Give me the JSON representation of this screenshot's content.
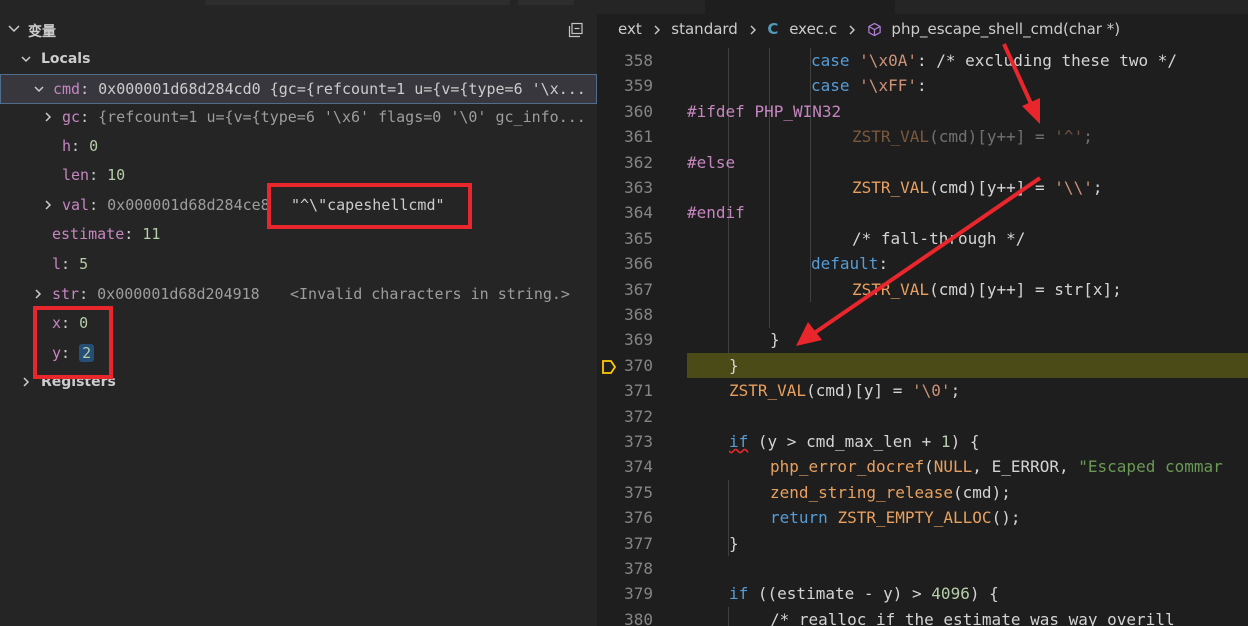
{
  "variables": {
    "section_title": "变量",
    "locals_label": "Locals",
    "rows": {
      "cmd": {
        "name": "cmd",
        "value": "0x000001d68d284cd0 {gc={refcount=1 u={v={type=6 '\\x..."
      },
      "gc": {
        "name": "gc",
        "value": "{refcount=1 u={v={type=6 '\\x6' flags=0 '\\0' gc_info..."
      },
      "h": {
        "name": "h",
        "value": "0"
      },
      "len": {
        "name": "len",
        "value": "10"
      },
      "val": {
        "name": "val",
        "addr": "0x000001d68d284ce8",
        "value": "\"^\\\"capeshellcmd\""
      },
      "estimate": {
        "name": "estimate",
        "value": "11"
      },
      "l": {
        "name": "l",
        "value": "5"
      },
      "str": {
        "name": "str",
        "addr": "0x000001d68d204918",
        "value": "<Invalid characters in string.>"
      },
      "x": {
        "name": "x",
        "value": "0"
      },
      "y": {
        "name": "y",
        "value": "2"
      }
    },
    "registers_label": "Registers"
  },
  "breadcrumb": {
    "items": [
      "ext",
      "standard",
      "exec.c",
      "php_escape_shell_cmd(char *)"
    ],
    "file_icon_text": "C"
  },
  "code": {
    "line_numbers": [
      "358",
      "359",
      "360",
      "361",
      "362",
      "363",
      "364",
      "365",
      "366",
      "367",
      "368",
      "369",
      "370",
      "371",
      "372",
      "373",
      "374",
      "375",
      "376",
      "377",
      "378",
      "379",
      "380"
    ],
    "current_line": "370",
    "tokens": {
      "l358": [
        "case",
        "'\\x0A'",
        ": ",
        "/* excluding these two */"
      ],
      "l359": [
        "case",
        "'\\xFF'",
        ":"
      ],
      "l360": [
        "#ifdef",
        "PHP_WIN32"
      ],
      "l361": [
        "ZSTR_VAL",
        "(cmd)[y++] = ",
        "'^'",
        ";"
      ],
      "l362": [
        "#else"
      ],
      "l363": [
        "ZSTR_VAL",
        "(cmd)[y++] = ",
        "'\\\\'",
        ";"
      ],
      "l364": [
        "#endif"
      ],
      "l365": [
        "/* fall-through */"
      ],
      "l366": [
        "default",
        ":"
      ],
      "l367": [
        "ZSTR_VAL",
        "(cmd)[y++] = str[x];"
      ],
      "l369": [
        "}"
      ],
      "l370": [
        "}"
      ],
      "l371": [
        "ZSTR_VAL",
        "(cmd)[y] = ",
        "'\\0'",
        ";"
      ],
      "l373": [
        "if",
        " (y > cmd_max_len + ",
        "1",
        ") {"
      ],
      "l374": [
        "php_error_docref",
        "(",
        "NULL",
        ", ",
        "E_ERROR",
        ", ",
        "\"Escaped commar"
      ],
      "l375": [
        "zend_string_release",
        "(cmd);"
      ],
      "l376": [
        "return",
        " ",
        "ZSTR_EMPTY_ALLOC",
        "();"
      ],
      "l377": [
        "}"
      ],
      "l379": [
        "if",
        " ((estimate - y) > ",
        "4096",
        ") {"
      ],
      "l380": [
        "/* realloc if the estimate was way overill"
      ]
    }
  },
  "colors": {
    "annotation_red": "#e8262b",
    "current_line_bg": "#4b4b18",
    "selected_row_bg": "#37373d"
  }
}
